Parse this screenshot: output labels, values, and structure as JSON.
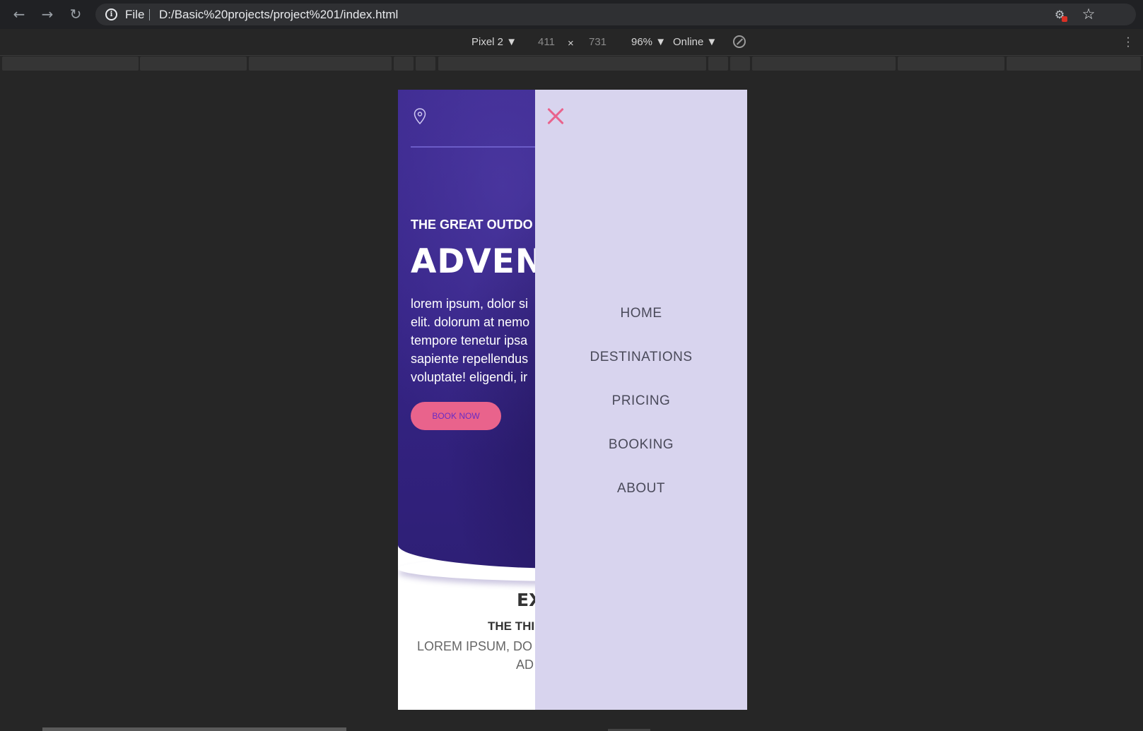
{
  "browser": {
    "scheme": "File",
    "url": "D:/Basic%20projects/project%201/index.html"
  },
  "devtools": {
    "device": "Pixel 2 ▼",
    "width": "411",
    "times": "×",
    "height": "731",
    "zoom": "96% ▼",
    "network": "Online ▼"
  },
  "page": {
    "hero_kicker": "THE GREAT OUTDO",
    "hero_title": "ADVENT",
    "hero_text": [
      "lorem ipsum, dolor si",
      "elit. dolorum at nemo",
      "tempore tenetur ipsa",
      "sapiente repellendus",
      "voluptate! eligendi, ir"
    ],
    "book_button": "BOOK NOW",
    "section_title": "EX",
    "section_sub": "THE THI",
    "section_body_1": "LOREM IPSUM, DO",
    "section_body_2": "AD"
  },
  "menu": {
    "items": [
      "HOME",
      "DESTINATIONS",
      "PRICING",
      "BOOKING",
      "ABOUT"
    ]
  },
  "colors": {
    "accent": "#e9638c",
    "menu_bg": "#d8d4ee",
    "hero": "#3d2a8f"
  }
}
